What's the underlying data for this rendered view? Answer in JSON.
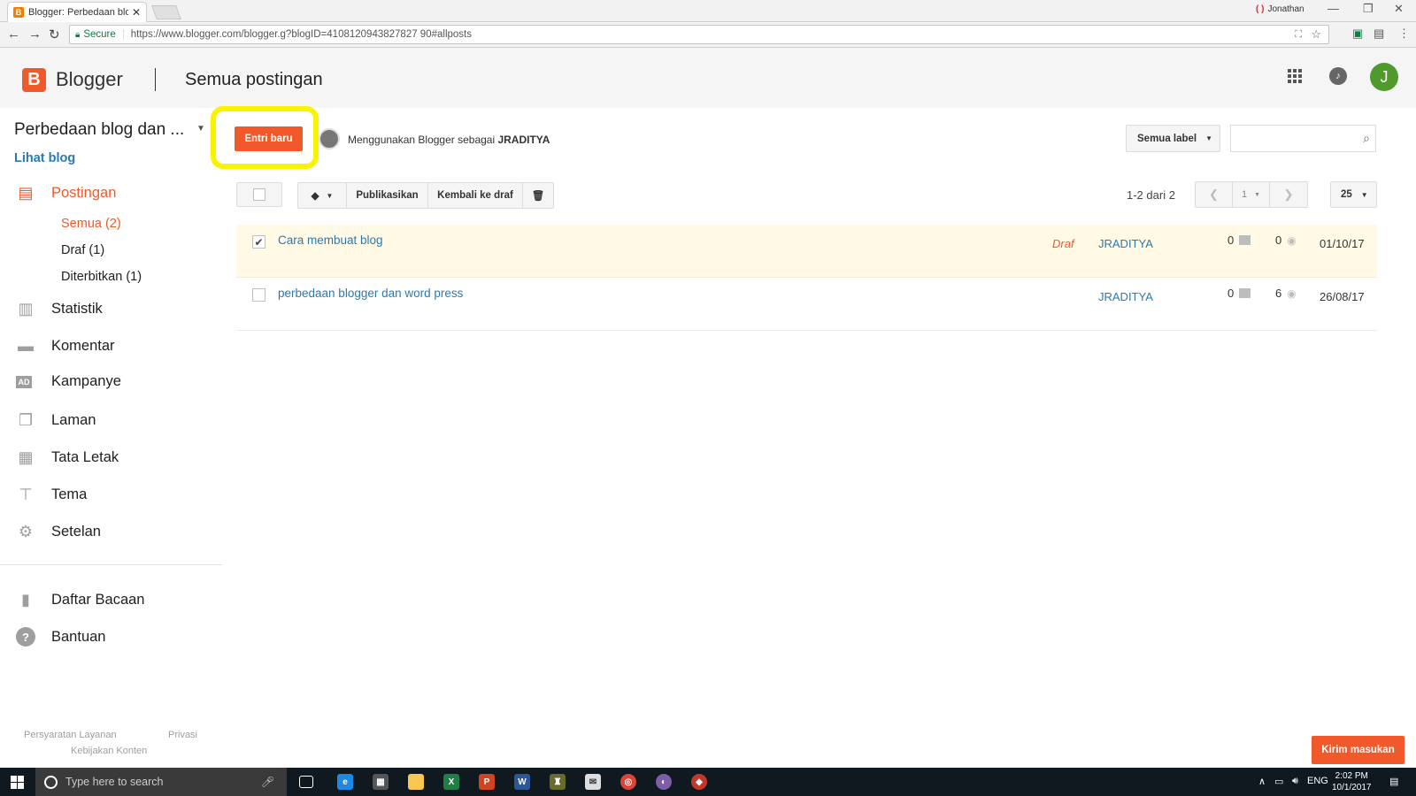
{
  "browser": {
    "tab_title": "Blogger: Perbedaan blog",
    "tab_close": "✕",
    "profile_name": "Jonathan",
    "secure_label": "Secure",
    "url": "https://www.blogger.com/blogger.g?blogID=4108120943827827 90#allposts"
  },
  "header": {
    "logo_letter": "B",
    "app_name": "Blogger",
    "page_title": "Semua postingan",
    "avatar_letter": "J"
  },
  "sidebar": {
    "blog_name": "Perbedaan blog dan ...",
    "view_blog": "Lihat blog",
    "posts_label": "Postingan",
    "sub_items": [
      {
        "label": "Semua (2)"
      },
      {
        "label": "Draf (1)"
      },
      {
        "label": "Diterbitkan (1)"
      }
    ],
    "nav": [
      {
        "label": "Statistik",
        "icon": "stats-icon"
      },
      {
        "label": "Komentar",
        "icon": "comment-icon"
      },
      {
        "label": "Kampanye",
        "icon": "ad-icon"
      },
      {
        "label": "Laman",
        "icon": "pages-icon"
      },
      {
        "label": "Tata Letak",
        "icon": "layout-icon"
      },
      {
        "label": "Tema",
        "icon": "theme-icon"
      },
      {
        "label": "Setelan",
        "icon": "settings-icon"
      }
    ],
    "reading_list": "Daftar Bacaan",
    "help": "Bantuan",
    "footer": {
      "terms": "Persyaratan Layanan",
      "privacy": "Privasi",
      "content_policy": "Kebijakan Konten"
    }
  },
  "actions": {
    "new_post": "Entri baru",
    "using_as_prefix": "Menggunakan Blogger sebagai",
    "username": "JRADITYA",
    "label_filter": "Semua label",
    "search_placeholder": ""
  },
  "toolbar": {
    "publish": "Publikasikan",
    "revert_draft": "Kembali ke draf",
    "page_info": "1-2 dari 2",
    "page_number": "1",
    "per_page": "25"
  },
  "posts": [
    {
      "title": "Cara membuat blog",
      "status": "Draf",
      "author": "JRADITYA",
      "comments": "0",
      "views": "0",
      "date": "01/10/17",
      "checked": "✔"
    },
    {
      "title": "perbedaan blogger dan word press",
      "status": "",
      "author": "JRADITYA",
      "comments": "0",
      "views": "6",
      "date": "26/08/17",
      "checked": ""
    }
  ],
  "feedback": "Kirim masukan",
  "taskbar": {
    "search_placeholder": "Type here to search",
    "lang": "ENG",
    "time": "2:02 PM",
    "date": "10/1/2017"
  },
  "colors": {
    "accent": "#f1592a",
    "link": "#2a7ab0",
    "highlight": "#f8f400"
  }
}
